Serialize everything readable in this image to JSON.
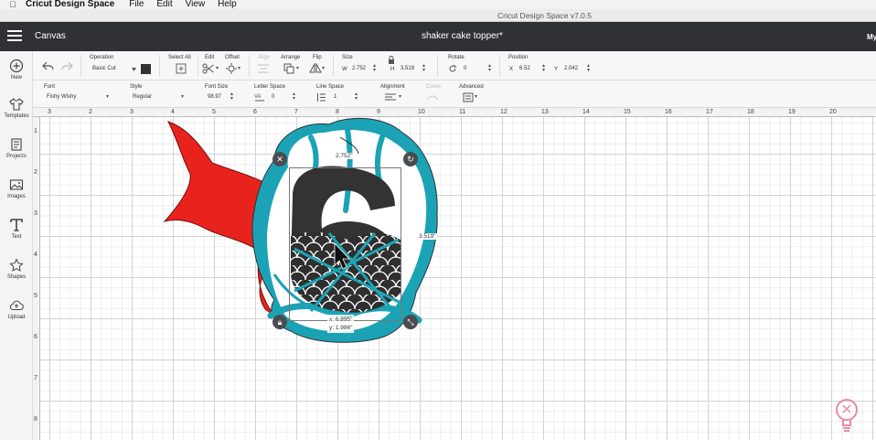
{
  "menubar": {
    "app": "Cricut Design Space",
    "items": [
      "File",
      "Edit",
      "View",
      "Help"
    ]
  },
  "window": {
    "title": "Cricut Design Space  v7.0.5"
  },
  "header": {
    "section": "Canvas",
    "project": "shaker cake topper*",
    "account": "My"
  },
  "sidebar": {
    "items": [
      {
        "label": "New",
        "icon": "plus-circle-icon"
      },
      {
        "label": "Templates",
        "icon": "shirt-icon"
      },
      {
        "label": "Projects",
        "icon": "projects-icon"
      },
      {
        "label": "Images",
        "icon": "image-icon"
      },
      {
        "label": "Text",
        "icon": "text-t-icon"
      },
      {
        "label": "Shapes",
        "icon": "shapes-icon"
      },
      {
        "label": "Upload",
        "icon": "cloud-upload-icon"
      }
    ]
  },
  "toolbar": {
    "operation": {
      "label": "Operation",
      "value": "Basic Cut",
      "swatch": "#333333"
    },
    "select_all": "Select All",
    "edit": "Edit",
    "offset": "Offset",
    "align": "Align",
    "arrange": "Arrange",
    "flip": "Flip",
    "size": {
      "label": "Size",
      "w_label": "W",
      "w": "2.752",
      "h_label": "H",
      "h": "3.519"
    },
    "rotate": {
      "label": "Rotate",
      "value": "0"
    },
    "position": {
      "label": "Position",
      "x_label": "X",
      "x": "6.52",
      "y_label": "Y",
      "y": "2.042"
    }
  },
  "textbar": {
    "font": {
      "label": "Font",
      "value": "Fishy Wishy"
    },
    "style": {
      "label": "Style",
      "value": "Regular"
    },
    "font_size": {
      "label": "Font Size",
      "value": "98.97"
    },
    "letter_space": {
      "label": "Letter Space",
      "value": "0"
    },
    "line_space": {
      "label": "Line Space",
      "value": "1"
    },
    "alignment": "Alignment",
    "curve": "Curve",
    "advanced": "Advanced"
  },
  "ruler": {
    "top": [
      "3",
      "2",
      "3",
      "4",
      "5",
      "6",
      "7",
      "8",
      "9",
      "10",
      "11",
      "12",
      "13",
      "14",
      "15",
      "16",
      "17",
      "18",
      "19",
      "20"
    ],
    "left": [
      "1",
      "2",
      "3",
      "4",
      "5",
      "6",
      "7",
      "8"
    ]
  },
  "selection": {
    "width_label": "2.752\"",
    "height_label": "3.519\"",
    "cursor_x": "x: 6.895\"",
    "cursor_y": "y: 1.986\""
  },
  "colors": {
    "header": "#2f3135",
    "accent_teal": "#1ba3b5",
    "tail_red": "#e8231e",
    "number_dark": "#333333"
  }
}
